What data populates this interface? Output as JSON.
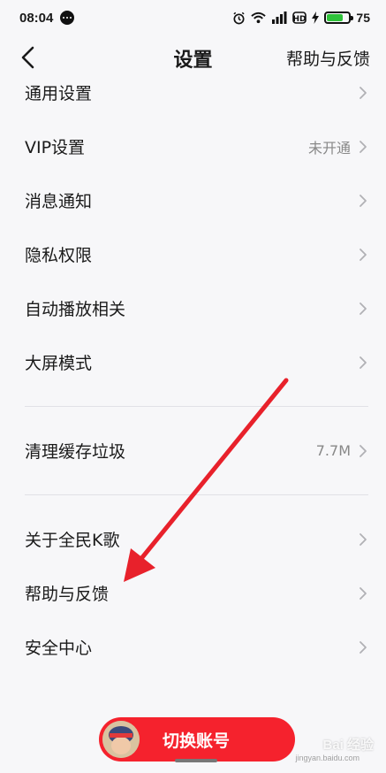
{
  "status_bar": {
    "time": "08:04",
    "battery_level": "75",
    "battery_fraction": 0.75,
    "icons": [
      "alarm-icon",
      "wifi-icon",
      "signal-icon",
      "hd-icon",
      "charging-icon"
    ]
  },
  "nav": {
    "title": "设置",
    "help_label": "帮助与反馈",
    "back_icon": "chevron-left-icon"
  },
  "settings": {
    "items": [
      {
        "label": "通用设置",
        "value": ""
      },
      {
        "label": "VIP设置",
        "value": "未开通"
      },
      {
        "label": "消息通知",
        "value": ""
      },
      {
        "label": "隐私权限",
        "value": ""
      },
      {
        "label": "自动播放相关",
        "value": ""
      },
      {
        "label": "大屏模式",
        "value": ""
      },
      {
        "label": "清理缓存垃圾",
        "value": "7.7M"
      },
      {
        "label": "关于全民K歌",
        "value": ""
      },
      {
        "label": "帮助与反馈",
        "value": ""
      },
      {
        "label": "安全中心",
        "value": ""
      }
    ]
  },
  "switch_account": {
    "label": "切换账号"
  },
  "colors": {
    "accent": "#f5222d",
    "annotation_arrow": "#e8212b",
    "battery": "#2fc23a"
  },
  "watermark": {
    "text": "Bai 经验",
    "sub": "jingyan.baidu.com"
  }
}
